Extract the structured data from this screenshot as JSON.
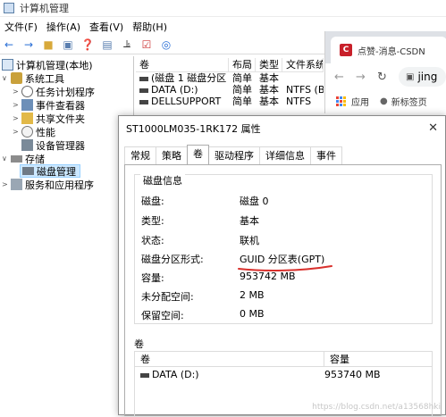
{
  "main_window": {
    "title": "计算机管理",
    "menu": [
      "文件(F)",
      "操作(A)",
      "查看(V)",
      "帮助(H)"
    ],
    "tree": {
      "root": "计算机管理(本地)",
      "system_tools": "系统工具",
      "task_scheduler": "任务计划程序",
      "event_viewer": "事件查看器",
      "shared_folders": "共享文件夹",
      "performance": "性能",
      "device_manager": "设备管理器",
      "storage": "存储",
      "disk_management": "磁盘管理",
      "services_apps": "服务和应用程序"
    },
    "volume_table": {
      "headers": [
        "卷",
        "布局",
        "类型",
        "文件系统"
      ],
      "rows": [
        [
          "(磁盘 1 磁盘分区 1)",
          "简单",
          "基本",
          ""
        ],
        [
          "DATA (D:)",
          "简单",
          "基本",
          "NTFS (BitL"
        ],
        [
          "DELLSUPPORT",
          "简单",
          "基本",
          "NTFS"
        ]
      ]
    }
  },
  "browser": {
    "tab_title": "点赞-消息-CSDN",
    "favicon_letter": "C",
    "omnibox_text": "jing",
    "bookmarks": {
      "apps": "应用",
      "new_tab": "新标签页"
    }
  },
  "dialog": {
    "title": "ST1000LM035-1RK172 属性",
    "tabs": [
      "常规",
      "策略",
      "卷",
      "驱动程序",
      "详细信息",
      "事件"
    ],
    "active_tab": "卷",
    "group_title": "磁盘信息",
    "fields": [
      {
        "label": "磁盘:",
        "value": "磁盘 0"
      },
      {
        "label": "类型:",
        "value": "基本"
      },
      {
        "label": "状态:",
        "value": "联机"
      },
      {
        "label": "磁盘分区形式:",
        "value": "GUID 分区表(GPT)"
      },
      {
        "label": "容量:",
        "value": "953742 MB"
      },
      {
        "label": "未分配空间:",
        "value": "2 MB"
      },
      {
        "label": "保留空间:",
        "value": "0 MB"
      }
    ],
    "volumes_label": "卷",
    "volume_list": {
      "headers": [
        "卷",
        "容量"
      ],
      "rows": [
        [
          "DATA (D:)",
          "953740 MB"
        ]
      ]
    }
  },
  "watermark": "https://blog.csdn.net/a13568hki",
  "colors": {
    "annotation_red": "#d9302c",
    "selection": "#cce8ff",
    "csdn_red": "#c8202a"
  }
}
